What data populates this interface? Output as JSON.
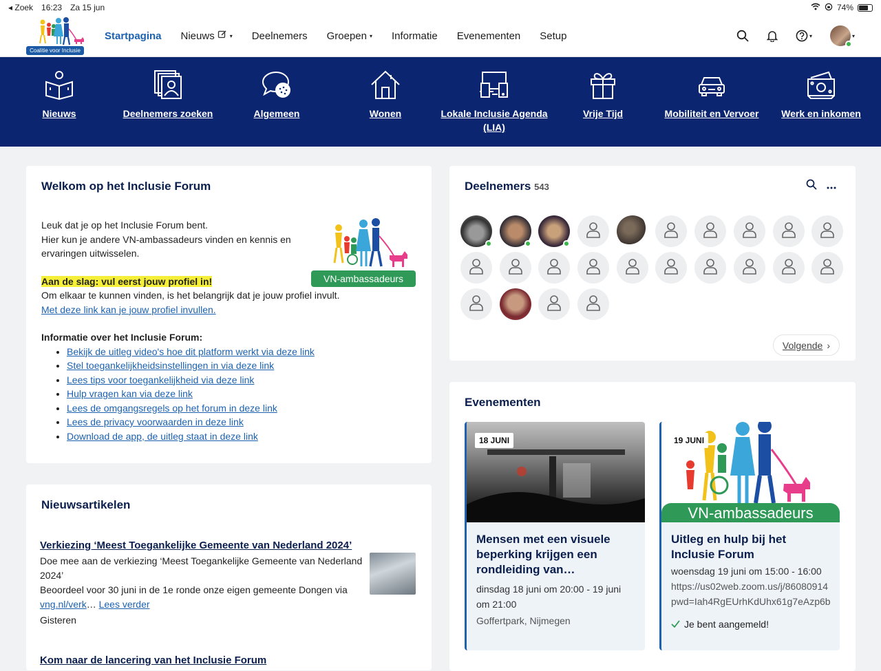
{
  "status_bar": {
    "back": "◂ Zoek",
    "time": "16:23",
    "date": "Za 15 jun",
    "battery": "74%",
    "battery_level": 0.74
  },
  "logo": {
    "caption": "Coalitie voor Inclusie"
  },
  "nav": {
    "items": [
      {
        "label": "Startpagina",
        "active": true
      },
      {
        "label": "Nieuws"
      },
      {
        "label": "Deelnemers"
      },
      {
        "label": "Groepen"
      },
      {
        "label": "Informatie"
      },
      {
        "label": "Evenementen"
      },
      {
        "label": "Setup"
      }
    ],
    "icons": [
      "search-icon",
      "bell-icon",
      "help-icon",
      "avatar"
    ]
  },
  "categories": [
    {
      "label": "Nieuws",
      "icon": "book-reader-icon"
    },
    {
      "label": "Deelnemers zoeken",
      "icon": "photo-stack-icon"
    },
    {
      "label": "Algemeen",
      "icon": "chat-bubbles-icon"
    },
    {
      "label": "Wonen",
      "icon": "house-icon"
    },
    {
      "label": "Lokale Inclusie Agenda (LIA)",
      "icon": "devices-icon"
    },
    {
      "label": "Vrije Tijd",
      "icon": "gift-icon"
    },
    {
      "label": "Mobiliteit en Vervoer",
      "icon": "car-icon"
    },
    {
      "label": "Werk en inkomen",
      "icon": "money-icon"
    }
  ],
  "welcome": {
    "title": "Welkom op het Inclusie Forum",
    "intro1": "Leuk dat je op het Inclusie Forum bent.",
    "intro2": "Hier kun je andere VN-ambassadeurs vinden en kennis en ervaringen uitwisselen.",
    "highlight": "Aan de slag: vul eerst jouw profiel in!",
    "text2": "Om elkaar te kunnen vinden, is het belangrijk dat je jouw profiel invult.",
    "profile_link": "Met deze link kan je jouw profiel invullen.",
    "info_heading": "Informatie over het Inclusie Forum:",
    "links": [
      "Bekijk de uitleg video's hoe dit platform werkt via deze link",
      "Stel toegankelijkheidsinstellingen in via deze link",
      "Lees tips voor toegankelijkheid via deze link",
      "Hulp vragen kan via deze link",
      "Lees de omgangsregels op het forum in deze link",
      "Lees de privacy voorwaarden in deze link",
      "Download de app, de uitleg staat in deze link"
    ],
    "logo_band": "VN-ambassadeurs"
  },
  "news": {
    "title": "Nieuwsartikelen",
    "article1": {
      "title": "Verkiezing ‘Meest Toegankelijke Gemeente van Nederland 2024’",
      "body": "Doe mee aan de verkiezing ‘Meest Toegankelijke Gemeente van Nederland 2024’",
      "body2": "Beoordeel voor 30 juni in de 1e ronde onze eigen gemeente Dongen via",
      "link": "vng.nl/verk",
      "ellipsis": "…",
      "more": "Lees verder",
      "date": "Gisteren"
    },
    "article2": {
      "title": "Kom naar de lancering van het Inclusie Forum"
    }
  },
  "members": {
    "title": "Deelnemers",
    "count": "543",
    "next": "Volgende",
    "avatars": [
      {
        "type": "photo1",
        "online": true
      },
      {
        "type": "photo2",
        "online": true
      },
      {
        "type": "photo3",
        "online": true
      },
      {
        "type": "placeholder"
      },
      {
        "type": "photo4"
      },
      {
        "type": "placeholder"
      },
      {
        "type": "placeholder"
      },
      {
        "type": "placeholder"
      },
      {
        "type": "placeholder"
      },
      {
        "type": "placeholder"
      },
      {
        "type": "placeholder"
      },
      {
        "type": "placeholder"
      },
      {
        "type": "placeholder"
      },
      {
        "type": "placeholder"
      },
      {
        "type": "placeholder"
      },
      {
        "type": "placeholder"
      },
      {
        "type": "placeholder"
      },
      {
        "type": "placeholder"
      },
      {
        "type": "placeholder"
      },
      {
        "type": "placeholder"
      },
      {
        "type": "placeholder"
      },
      {
        "type": "photo5"
      },
      {
        "type": "placeholder"
      },
      {
        "type": "placeholder"
      }
    ]
  },
  "events": {
    "title": "Evenementen",
    "items": [
      {
        "badge": "18 JUNI",
        "title": "Mensen met een visuele beperking krijgen een rondleiding van…",
        "time": "dinsdag 18 juni om 20:00 - 19 juni om 21:00",
        "location": "Goffertpark, Nijmegen"
      },
      {
        "badge": "19 JUNI",
        "title": "Uitleg en hulp bij het Inclusie Forum",
        "time": "woensdag 19 juni om 15:00 - 16:00",
        "url1": "https://us02web.zoom.us/j/86080914",
        "url2": "pwd=Iah4RgEUrhKdUhx61g7eAzp6b",
        "band": "VN-ambassadeurs",
        "status": "Je bent aangemeld!"
      }
    ]
  },
  "colors": {
    "nav_blue": "#0b2570",
    "link": "#1c62b0",
    "online": "#3cb64a",
    "highlight": "#f5ef3a",
    "brand_green": "#2f9a57"
  }
}
